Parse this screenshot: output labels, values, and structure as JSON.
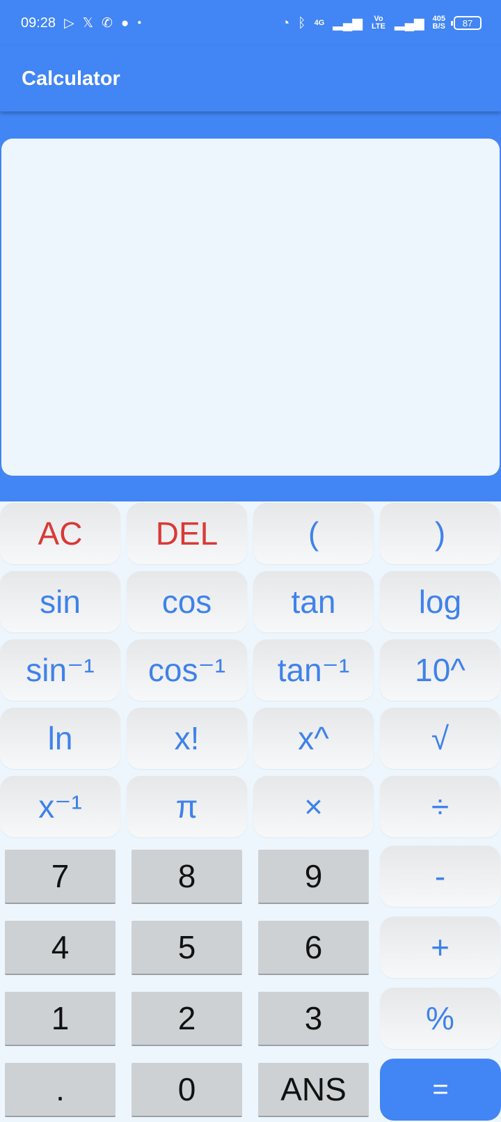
{
  "status_bar": {
    "time": "09:28",
    "left_icons": [
      "play-store-icon",
      "x-twitter-icon",
      "whatsapp-icon",
      "chat-bubble-icon",
      "dot-icon"
    ],
    "network_4g": "4G",
    "volte": "Vo LTE",
    "speed_value": "405",
    "speed_unit": "B/S",
    "battery": "87"
  },
  "app_bar": {
    "title": "Calculator"
  },
  "display": {
    "expression": "",
    "result": ""
  },
  "keys": {
    "ac": "AC",
    "del": "DEL",
    "lparen": "(",
    "rparen": ")",
    "sin": "sin",
    "cos": "cos",
    "tan": "tan",
    "log": "log",
    "asin": "sin⁻¹",
    "acos": "cos⁻¹",
    "atan": "tan⁻¹",
    "pow10": "10^",
    "ln": "ln",
    "fact": "x!",
    "pow": "x^",
    "sqrt": "√",
    "inv": "x⁻¹",
    "pi": "π",
    "mul": "×",
    "div": "÷",
    "n7": "7",
    "n8": "8",
    "n9": "9",
    "minus": "-",
    "n4": "4",
    "n5": "5",
    "n6": "6",
    "plus": "+",
    "n1": "1",
    "n2": "2",
    "n3": "3",
    "percent": "%",
    "dot": ".",
    "n0": "0",
    "ans": "ANS",
    "equals": "="
  },
  "colors": {
    "primary": "#4285f4",
    "function_text": "#3f82ea",
    "clear_text": "#d83a36",
    "number_key": "#cdd1d4",
    "display_bg": "#eef6fd"
  }
}
